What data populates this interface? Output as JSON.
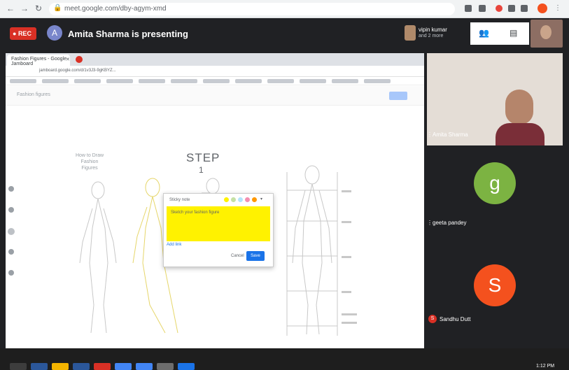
{
  "browser": {
    "url": "meet.google.com/dby-agym-xmd",
    "back_icon": "arrow-left-icon",
    "forward_icon": "arrow-right-icon",
    "reload_icon": "reload-icon"
  },
  "meet": {
    "rec_label": "REC",
    "presenter_initial": "A",
    "presenting_text": "Amita Sharma is presenting",
    "you": {
      "name": "vipin kumar",
      "sub": "and 2 more"
    },
    "colors": {
      "background": "#202124",
      "rec": "#d93025"
    }
  },
  "presentation": {
    "tab_label": "Fashion Figures - Google Jamboard",
    "url": "jamboard.google.com/d/1v3J3-9gKBYZ...",
    "doc_title": "Fashion figures",
    "step_title": "STEP",
    "step_number": "1",
    "side_note": "How to Draw Fashion Figures",
    "note": {
      "title": "Sticky note",
      "text": "Sketch your fashion figure",
      "link": "Add link",
      "cancel": "Cancel",
      "done": "Save"
    }
  },
  "participants": [
    {
      "name": "Amita Sharma",
      "initial": "",
      "color": ""
    },
    {
      "name": "geeta pandey",
      "initial": "g",
      "color": "#7cb342"
    },
    {
      "name": "Sandhu Dutt",
      "initial": "S",
      "color": "#f4511e"
    }
  ],
  "taskbar": {
    "clock": "1:12 PM"
  }
}
